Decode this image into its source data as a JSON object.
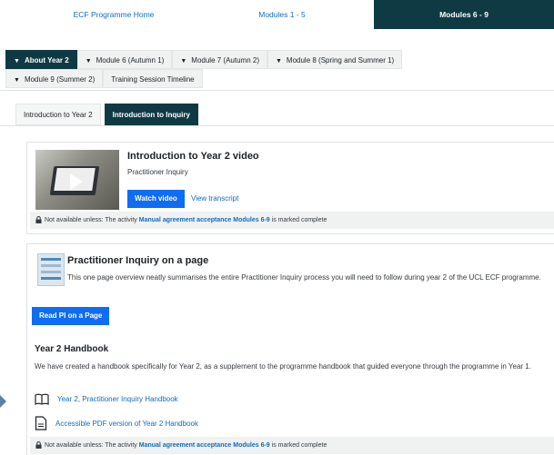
{
  "topnav": {
    "items": [
      "ECF Programme Home",
      "Modules 1 - 5",
      "Modules 6 - 9"
    ]
  },
  "module_tabs": {
    "row1": [
      "About Year 2",
      "Module 6 (Autumn 1)",
      "Module 7 (Autumn 2)",
      "Module 8 (Spring and Summer 1)"
    ],
    "row2": [
      "Module 9 (Summer 2)",
      "Training Session Timeline"
    ]
  },
  "sub_tabs": [
    "Introduction to Year 2",
    "Introduction to Inquiry"
  ],
  "video": {
    "title": "Introduction to Year 2 video",
    "subtitle": "Practitioner Inquiry",
    "watch_label": "Watch video",
    "transcript_label": "View transcript"
  },
  "restriction": {
    "prefix": "Not available unless: The activity",
    "activity": "Manual agreement acceptance Modules 6-9",
    "suffix": "is marked complete"
  },
  "pi_page": {
    "title": "Practitioner Inquiry on a page",
    "description": "This one page overview neatly summarises the entire Practitioner Inquiry process you will need to follow during year 2 of the UCL ECF programme.",
    "button_label": "Read PI on a Page"
  },
  "handbook": {
    "title": "Year 2 Handbook",
    "description": "We have created a handbook specifically for Year 2, as a supplement to the programme handbook that guided everyone through the programme in Year 1.",
    "link1": "Year 2, Practitioner Inquiry Handbook",
    "link2": "Accessible PDF version of Year 2 Handbook"
  },
  "colors": {
    "accent_dark": "#0f3a44",
    "button_blue": "#0f6cf4",
    "link_blue": "#0f6cbf"
  }
}
